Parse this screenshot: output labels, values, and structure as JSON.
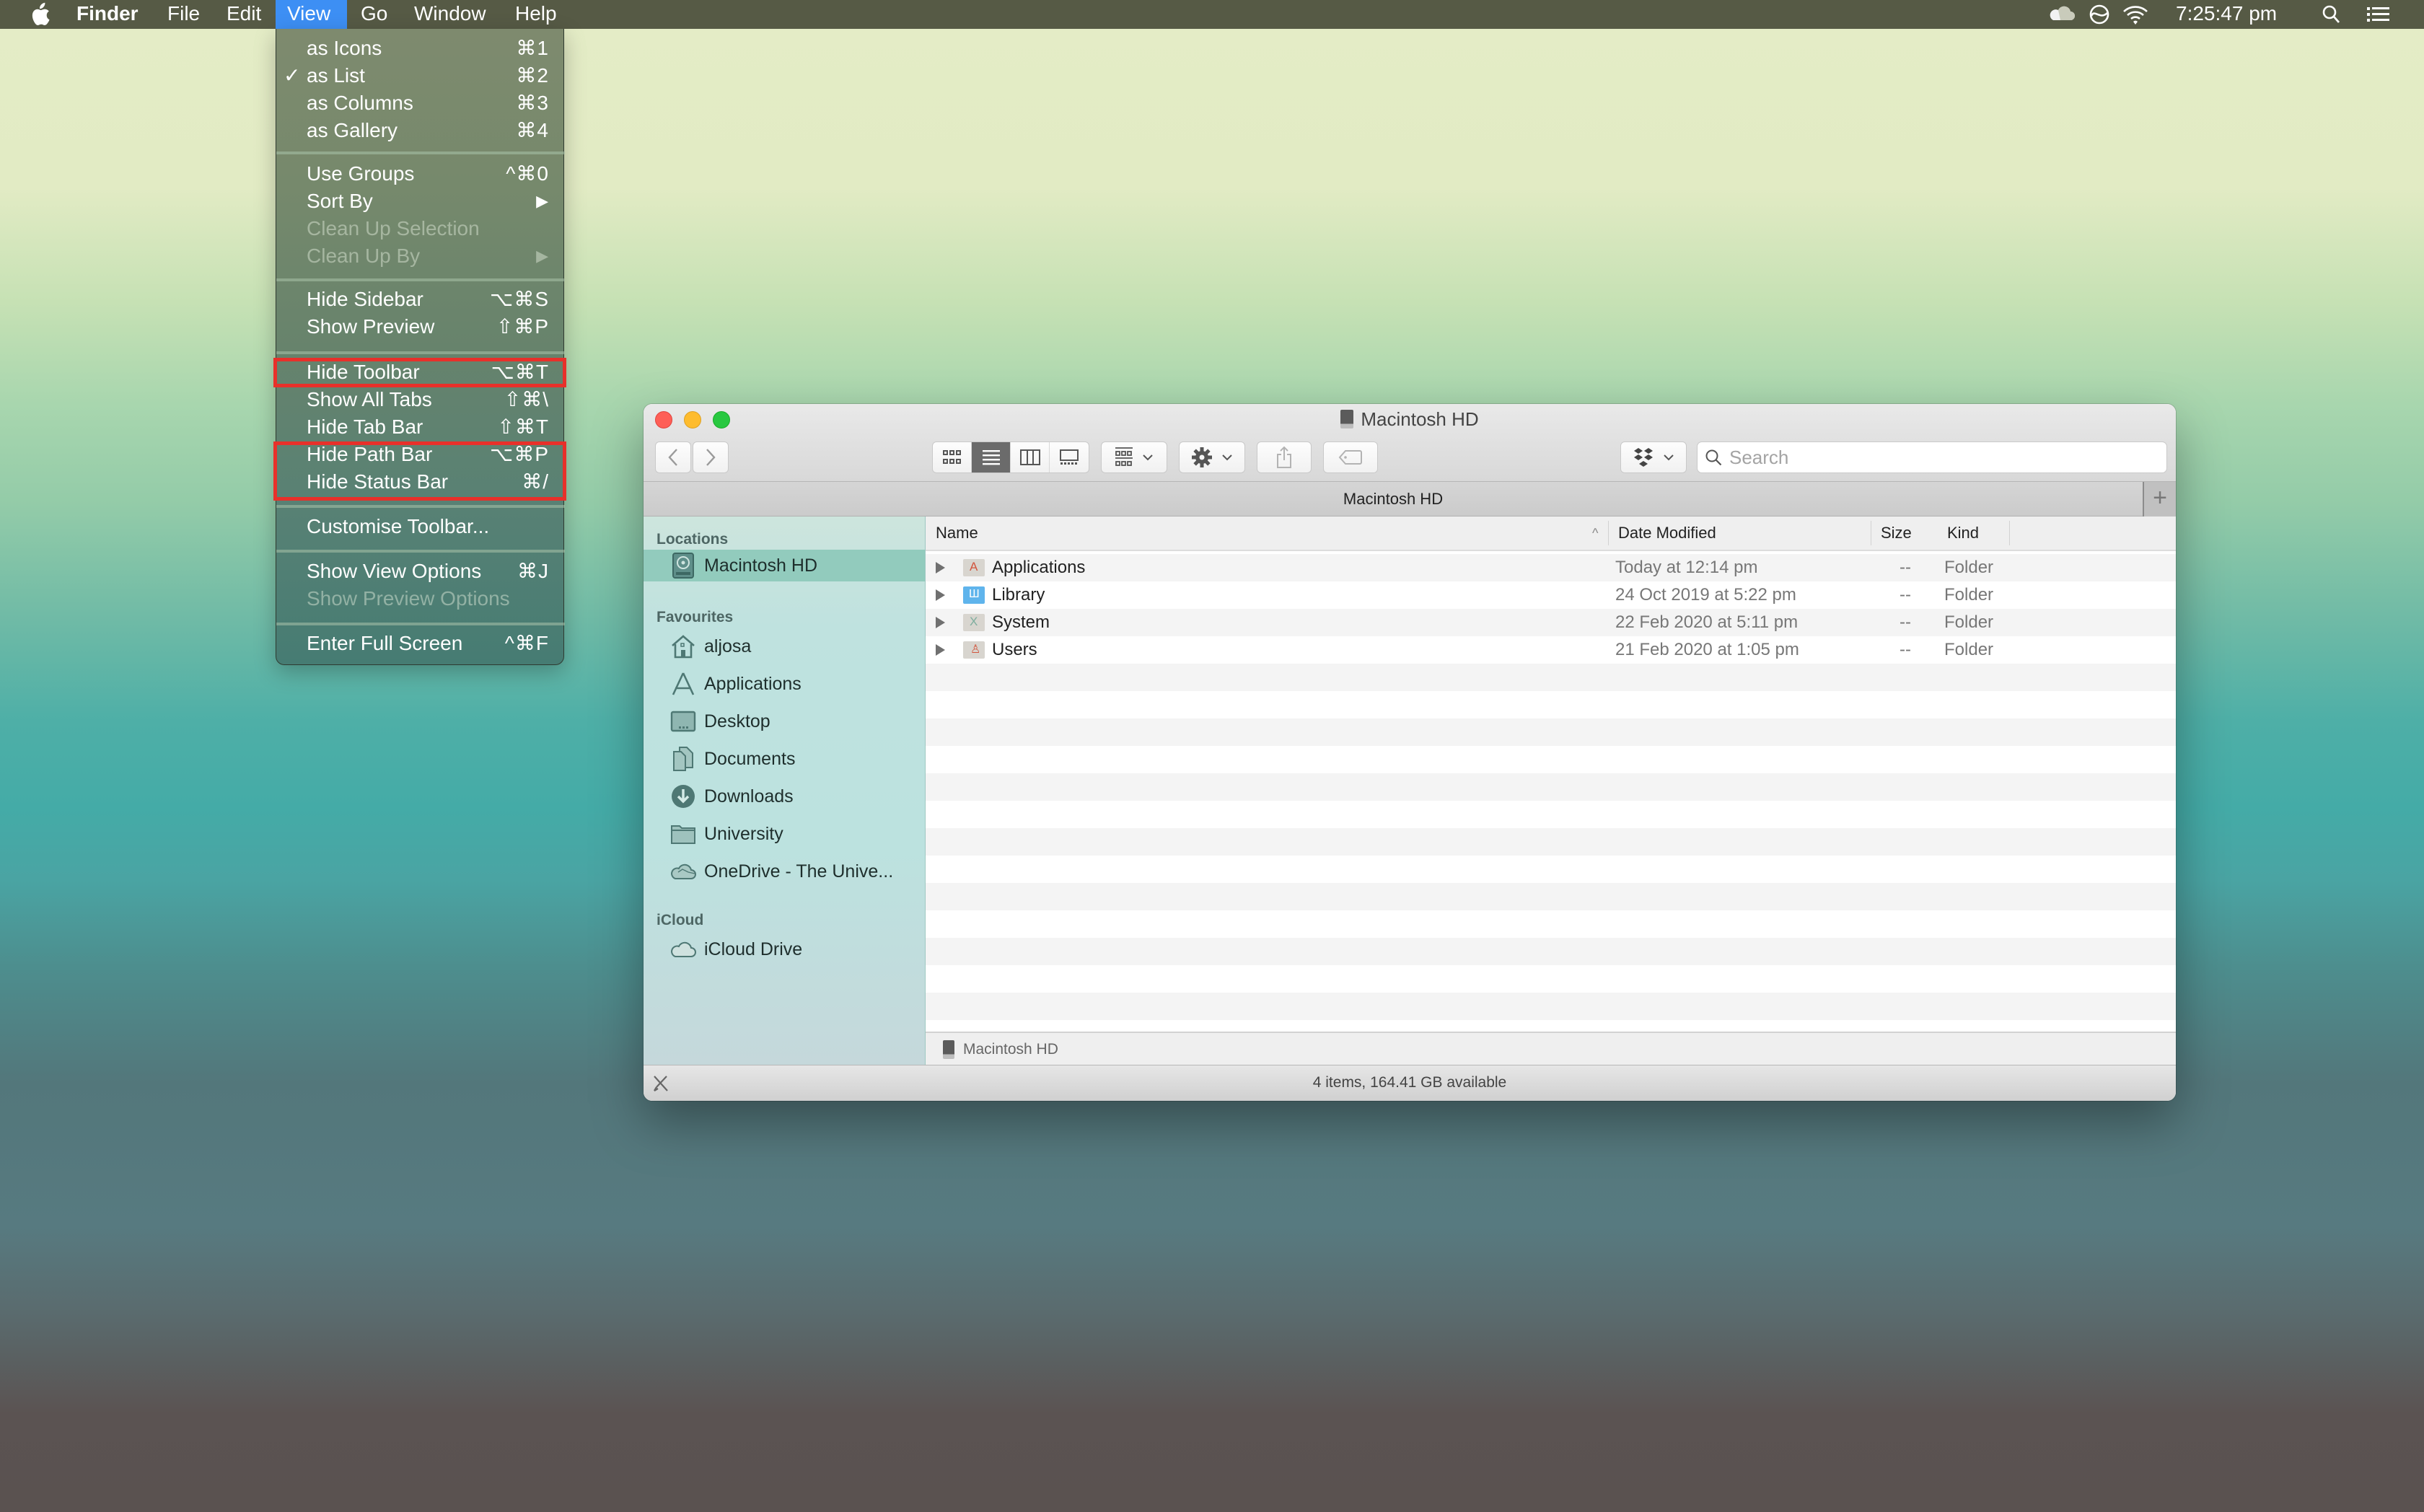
{
  "menubar": {
    "app_name": "Finder",
    "menus": [
      "File",
      "Edit",
      "View",
      "Go",
      "Window",
      "Help"
    ],
    "active_menu": "View",
    "clock": "7:25:47 pm",
    "tray_icons": [
      "onedrive-icon",
      "sync-icon",
      "wifi-icon",
      "spotlight-search-icon",
      "notification-center-icon"
    ]
  },
  "view_menu": {
    "items": [
      {
        "label": "as Icons",
        "shortcut": "⌘1",
        "checked": false,
        "disabled": false
      },
      {
        "label": "as List",
        "shortcut": "⌘2",
        "checked": true,
        "disabled": false
      },
      {
        "label": "as Columns",
        "shortcut": "⌘3",
        "checked": false,
        "disabled": false
      },
      {
        "label": "as Gallery",
        "shortcut": "⌘4",
        "checked": false,
        "disabled": false
      },
      {
        "label": "Use Groups",
        "shortcut": "^⌘0",
        "checked": false,
        "disabled": false
      },
      {
        "label": "Sort By",
        "shortcut": "▶",
        "checked": false,
        "disabled": false
      },
      {
        "label": "Clean Up Selection",
        "shortcut": "",
        "checked": false,
        "disabled": true
      },
      {
        "label": "Clean Up By",
        "shortcut": "▶",
        "checked": false,
        "disabled": true
      },
      {
        "label": "Hide Sidebar",
        "shortcut": "⌥⌘S",
        "checked": false,
        "disabled": false
      },
      {
        "label": "Show Preview",
        "shortcut": "⇧⌘P",
        "checked": false,
        "disabled": false
      },
      {
        "label": "Hide Toolbar",
        "shortcut": "⌥⌘T",
        "checked": false,
        "disabled": false,
        "highlighted": true
      },
      {
        "label": "Show All Tabs",
        "shortcut": "⇧⌘\\",
        "checked": false,
        "disabled": false
      },
      {
        "label": "Hide Tab Bar",
        "shortcut": "⇧⌘T",
        "checked": false,
        "disabled": false
      },
      {
        "label": "Hide Path Bar",
        "shortcut": "⌥⌘P",
        "checked": false,
        "disabled": false,
        "highlighted": true
      },
      {
        "label": "Hide Status Bar",
        "shortcut": "⌘/",
        "checked": false,
        "disabled": false,
        "highlighted": true
      },
      {
        "label": "Customise Toolbar...",
        "shortcut": "",
        "checked": false,
        "disabled": false
      },
      {
        "label": "Show View Options",
        "shortcut": "⌘J",
        "checked": false,
        "disabled": false
      },
      {
        "label": "Show Preview Options",
        "shortcut": "",
        "checked": false,
        "disabled": true
      },
      {
        "label": "Enter Full Screen",
        "shortcut": "^⌘F",
        "checked": false,
        "disabled": false
      }
    ],
    "check_glyph": "✓",
    "highlight_color": "#e8302a"
  },
  "window": {
    "title": "Macintosh HD",
    "tab_label": "Macintosh HD",
    "search_placeholder": "Search",
    "search_value": "",
    "view_mode": "list",
    "toolbar": {
      "back": "‹",
      "forward": "›",
      "view_modes": [
        "icons",
        "list",
        "columns",
        "gallery"
      ],
      "group_by": "group-icon",
      "action": "gear-icon",
      "share": "share-icon",
      "tags": "tag-icon",
      "dropbox": "dropbox-icon"
    }
  },
  "sidebar": {
    "sections": [
      {
        "header": "Locations",
        "items": [
          {
            "label": "Macintosh HD",
            "icon": "hard-drive-icon",
            "selected": true
          }
        ]
      },
      {
        "header": "Favourites",
        "items": [
          {
            "label": "aljosa",
            "icon": "home-icon",
            "selected": false
          },
          {
            "label": "Applications",
            "icon": "applications-icon",
            "selected": false
          },
          {
            "label": "Desktop",
            "icon": "desktop-icon",
            "selected": false
          },
          {
            "label": "Documents",
            "icon": "documents-icon",
            "selected": false
          },
          {
            "label": "Downloads",
            "icon": "downloads-icon",
            "selected": false
          },
          {
            "label": "University",
            "icon": "folder-icon",
            "selected": false
          },
          {
            "label": "OneDrive - The Unive...",
            "icon": "onedrive-icon",
            "selected": false
          }
        ]
      },
      {
        "header": "iCloud",
        "items": [
          {
            "label": "iCloud Drive",
            "icon": "icloud-icon",
            "selected": false
          }
        ]
      }
    ]
  },
  "file_list": {
    "columns": [
      "Name",
      "Date Modified",
      "Size",
      "Kind"
    ],
    "sort_column": "Name",
    "sort_direction": "ascending",
    "rows": [
      {
        "name": "Applications",
        "date": "Today at 12:14 pm",
        "size": "--",
        "kind": "Folder",
        "icon": "applications-folder-icon",
        "icon_color": "#d8d5cf"
      },
      {
        "name": "Library",
        "date": "24 Oct 2019 at 5:22 pm",
        "size": "--",
        "kind": "Folder",
        "icon": "library-folder-icon",
        "icon_color": "#5fb4ec"
      },
      {
        "name": "System",
        "date": "22 Feb 2020 at 5:11 pm",
        "size": "--",
        "kind": "Folder",
        "icon": "system-folder-icon",
        "icon_color": "#d8d5cf"
      },
      {
        "name": "Users",
        "date": "21 Feb 2020 at 1:05 pm",
        "size": "--",
        "kind": "Folder",
        "icon": "users-folder-icon",
        "icon_color": "#d8d5cf"
      }
    ]
  },
  "path_bar": {
    "items": [
      "Macintosh HD"
    ]
  },
  "status_bar": {
    "text": "4 items, 164.41 GB available"
  }
}
